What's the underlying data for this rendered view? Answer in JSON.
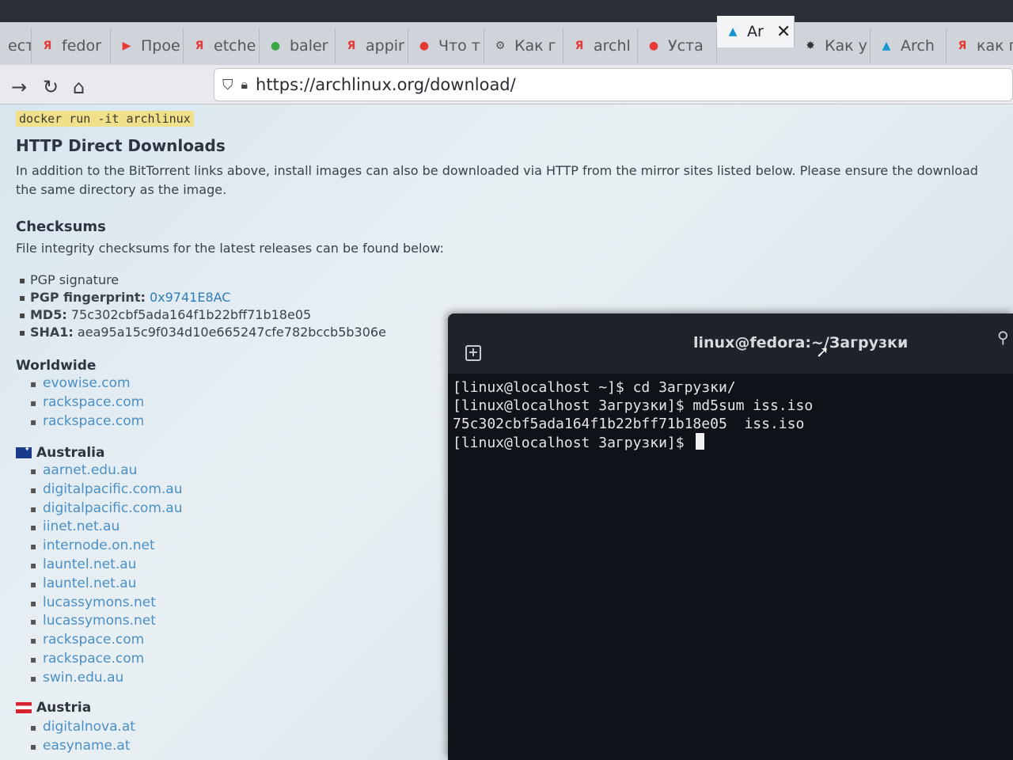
{
  "browser": {
    "tabs": [
      {
        "label": "ест",
        "icon": "",
        "color": "#888888"
      },
      {
        "label": "fedor",
        "icon": "Я",
        "color": "#e53935"
      },
      {
        "label": "Прое",
        "icon": "▶",
        "color": "#e53935"
      },
      {
        "label": "etche",
        "icon": "Я",
        "color": "#e53935"
      },
      {
        "label": "baler",
        "icon": "●",
        "color": "#3aa545"
      },
      {
        "label": "appir",
        "icon": "Я",
        "color": "#e53935"
      },
      {
        "label": "Что т",
        "icon": "●",
        "color": "#e53935"
      },
      {
        "label": "Как г",
        "icon": "⚙",
        "color": "#555555"
      },
      {
        "label": "archl",
        "icon": "Я",
        "color": "#e53935"
      },
      {
        "label": "Уста",
        "icon": "●",
        "color": "#e53935"
      },
      {
        "label": "Ar",
        "icon": "▲",
        "color": "#1793d1",
        "active": true
      },
      {
        "label": "Как у",
        "icon": "✸",
        "color": "#333333"
      },
      {
        "label": "Arch",
        "icon": "▲",
        "color": "#1793d1"
      },
      {
        "label": "как г",
        "icon": "Я",
        "color": "#e53935"
      }
    ],
    "url": "https://archlinux.org/download/"
  },
  "page": {
    "docker_cmd": "docker run -it archlinux",
    "http_heading": "HTTP Direct Downloads",
    "http_para_1": "In addition to the BitTorrent links above, install images can also be downloaded via HTTP from the mirror sites listed below. Please ensure the download",
    "http_para_2": "the same directory as the image.",
    "checksums_heading": "Checksums",
    "checksums_para": "File integrity checksums for the latest releases can be found below:",
    "pgp_signature": "PGP signature",
    "pgp_fingerprint_label": "PGP fingerprint:",
    "pgp_fingerprint_value": "0x9741E8AC",
    "md5_label": "MD5:",
    "md5_value": "75c302cbf5ada164f1b22bff71b18e05",
    "sha1_label": "SHA1:",
    "sha1_value": "aea95a15c9f034d10e665247cfe782bccb5b306e",
    "worldwide_heading": "Worldwide",
    "worldwide_mirrors": [
      "evowise.com",
      "rackspace.com",
      "rackspace.com"
    ],
    "australia_heading": "Australia",
    "australia_mirrors": [
      "aarnet.edu.au",
      "digitalpacific.com.au",
      "digitalpacific.com.au",
      "iinet.net.au",
      "internode.on.net",
      "launtel.net.au",
      "launtel.net.au",
      "lucassymons.net",
      "lucassymons.net",
      "rackspace.com",
      "rackspace.com",
      "swin.edu.au"
    ],
    "austria_heading": "Austria",
    "austria_mirrors": [
      "digitalnova.at",
      "easyname.at"
    ]
  },
  "terminal": {
    "title": "linux@fedora:~/Загрузки",
    "lines": [
      "[linux@localhost ~]$ cd Загрузки/",
      "[linux@localhost Загрузки]$ md5sum iss.iso",
      "75c302cbf5ada164f1b22bff71b18e05  iss.iso",
      "[linux@localhost Загрузки]$ "
    ]
  }
}
